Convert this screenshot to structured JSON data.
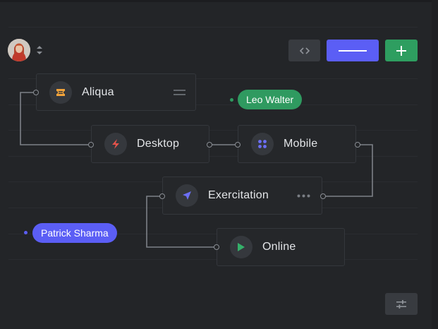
{
  "colors": {
    "background": "#232528",
    "node_bg": "#25272a",
    "node_border": "#34373c",
    "wire": "#8a8e94",
    "accent_purple": "#5b5ef5",
    "accent_green": "#2e9e60",
    "pill_green": "#2f9a60",
    "pill_purple": "#5b5ef5"
  },
  "header": {
    "avatar": "user-avatar",
    "sort_icon": "sort-updown-icon",
    "buttons": [
      {
        "name": "code-view",
        "icon": "code-arrows-icon"
      },
      {
        "name": "collapse",
        "icon": "minus-icon"
      },
      {
        "name": "add",
        "icon": "plus-icon"
      }
    ]
  },
  "nodes": [
    {
      "id": "aliqua",
      "label": "Aliqua",
      "icon": "ticket-icon",
      "icon_color": "#f2a33a",
      "menu_icon": "drag-handle-icon"
    },
    {
      "id": "desktop",
      "label": "Desktop",
      "icon": "lightning-icon",
      "icon_color": "#e5534b"
    },
    {
      "id": "mobile",
      "label": "Mobile",
      "icon": "grid-dots-icon",
      "icon_color": "#6c6ff5"
    },
    {
      "id": "exercitation",
      "label": "Exercitation",
      "icon": "navigation-arrow-icon",
      "icon_color": "#6c6ff5",
      "menu_icon": "more-dots-icon"
    },
    {
      "id": "online",
      "label": "Online",
      "icon": "play-icon",
      "icon_color": "#35b06a"
    }
  ],
  "tags": [
    {
      "id": "leo",
      "label": "Leo Walter",
      "color": "#2f9a60"
    },
    {
      "id": "patrick",
      "label": "Patrick Sharma",
      "color": "#5b5ef5"
    }
  ],
  "footer": {
    "settings_icon": "sliders-icon"
  }
}
